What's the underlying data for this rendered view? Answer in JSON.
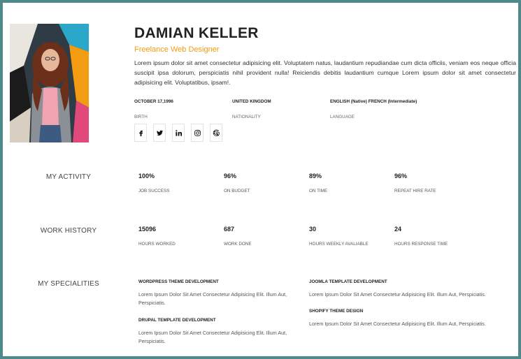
{
  "profile": {
    "name": "DAMIAN KELLER",
    "role": "Freelance Web Designer",
    "bio": "Lorem ipsum dolor sit amet consectetur adipisicing elit. Voluptatem natus, laudantium repudiandae cum dicta officiis, veniam eos neque officia suscipit ipsa dolorum, perspiciatis nihil provident nulla! Reiciendis debitis laudantium cumque Lorem ipsum dolor sit amet consectetur adipisicing elit. Voluptatibus, ipsam!."
  },
  "facts": [
    {
      "value": "OCTOBER 17,1996",
      "label": "BIRTH"
    },
    {
      "value": "UNITED KINGDOM",
      "label": "NATIONALITY"
    },
    {
      "value": "ENGLISH (Native) FRENCH (Intermediate)",
      "label": "LANGUAGE"
    }
  ],
  "socials": [
    {
      "icon": "facebook-icon"
    },
    {
      "icon": "twitter-icon"
    },
    {
      "icon": "linkedin-icon"
    },
    {
      "icon": "instagram-icon"
    },
    {
      "icon": "google-icon"
    }
  ],
  "activity": {
    "title": "MY ACTIVITY",
    "stats": [
      {
        "value": "100%",
        "label": "JOB SUCCESS"
      },
      {
        "value": "96%",
        "label": "ON BUDGET"
      },
      {
        "value": "89%",
        "label": "ON TIME"
      },
      {
        "value": "96%",
        "label": "REPEAT HIRE RATE"
      }
    ]
  },
  "history": {
    "title": "WORK HISTORY",
    "stats": [
      {
        "value": "15096",
        "label": "HOURS WORKED"
      },
      {
        "value": "687",
        "label": "WORK DONE"
      },
      {
        "value": "30",
        "label": "HOURS WEEKLY AVALIABLE"
      },
      {
        "value": "24",
        "label": "HOURS RESPONSE TIME"
      }
    ]
  },
  "specialities": {
    "title": "MY SPECIALITIES",
    "items": [
      {
        "title": "WORDPRESS THEME DEVELOPMENT",
        "text": "Lorem Ipsum Dolor Sit Amet Consectetur Adipisicing Elit. Illum Aut, Perspiciatis."
      },
      {
        "title": "DRUPAL TEMPLATE DEVELOPMENT",
        "text": "Lorem Ipsum Dolor Sit Amet Consectetur Adipisicing Elit. Illum Aut, Perspiciatis."
      },
      {
        "title": "JOOMLA TEMPLATE DEVELOPMENT",
        "text": "Lorem Ipsum Dolor Sit Amet Consectetur Adipisicing Elit. Illum Aut, Perspiciatis."
      },
      {
        "title": "SHOPIFY THEME DESIGN",
        "text": "Lorem Ipsum Dolor Sit Amet Consectetur Adipisicing Elit. Illum Aut, Perspiciatis."
      }
    ]
  },
  "colors": {
    "accent": "#f39c12",
    "frame": "#4f8a8b"
  }
}
